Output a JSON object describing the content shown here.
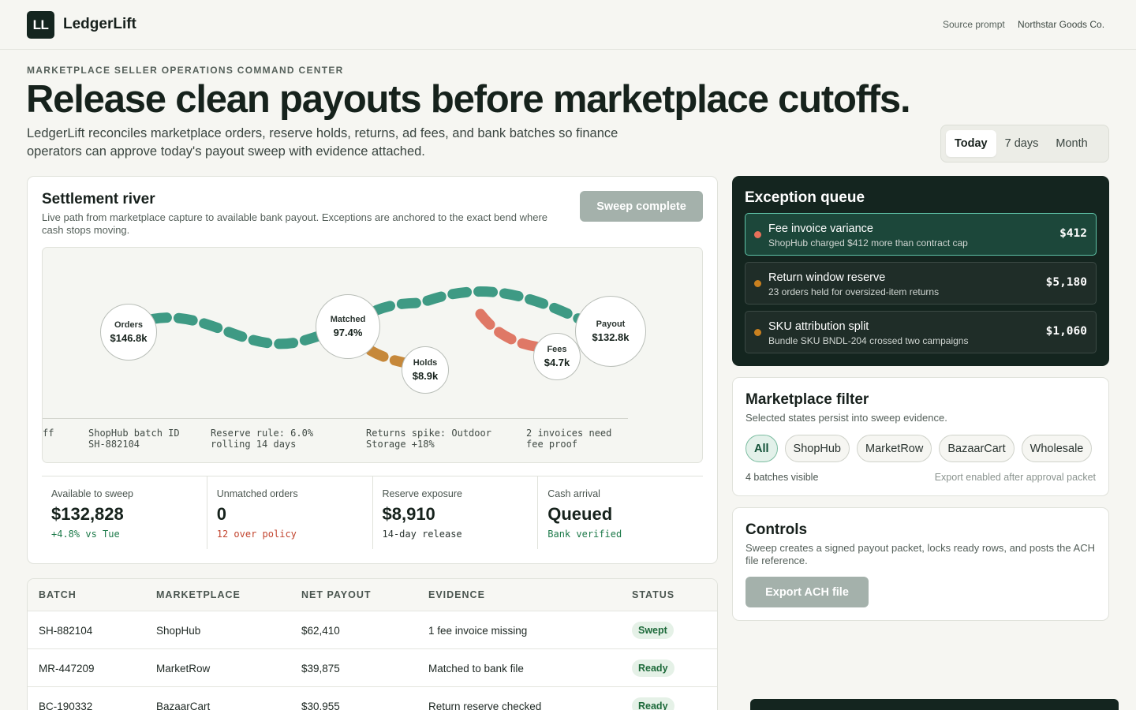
{
  "app": {
    "logo": "LL",
    "name": "LedgerLift",
    "source_label": "Source prompt",
    "source_value": "Northstar Goods Co."
  },
  "hero": {
    "eyebrow": "MARKETPLACE SELLER OPERATIONS COMMAND CENTER",
    "headline": "Release clean payouts before marketplace cutoffs.",
    "lede": "LedgerLift reconciles marketplace orders, reserve holds, returns, ad fees, and bank batches so finance operators can approve today's payout sweep with evidence attached."
  },
  "range": {
    "options": [
      "Today",
      "7 days",
      "Month"
    ],
    "selected": "Today"
  },
  "settlement": {
    "title": "Settlement river",
    "subtitle": "Live path from marketplace capture to available bank payout. Exceptions are anchored to the exact bend where cash stops moving.",
    "button": "Sweep complete",
    "nodes": {
      "orders": {
        "label": "Orders",
        "value": "$146.8k"
      },
      "matched": {
        "label": "Matched",
        "value": "97.4%"
      },
      "holds": {
        "label": "Holds",
        "value": "$8.9k"
      },
      "fees": {
        "label": "Fees",
        "value": "$4.7k"
      },
      "payout": {
        "label": "Payout",
        "value": "$132.8k"
      }
    },
    "annotations": [
      "ff",
      "ShopHub batch ID\nSH-882104",
      "Reserve rule: 6.0%\nrolling 14 days",
      "Returns spike: Outdoor\nStorage +18%",
      "2 invoices need\nfee proof"
    ],
    "colors": {
      "main": "#3e9a84",
      "holds": "#c6883a",
      "fees": "#df7866"
    }
  },
  "metrics": [
    {
      "label": "Available to sweep",
      "value": "$132,828",
      "note": "+4.8% vs Tue",
      "note_color": "#1d7a4a"
    },
    {
      "label": "Unmatched orders",
      "value": "0",
      "note": "12 over policy",
      "note_color": "#c2452f"
    },
    {
      "label": "Reserve exposure",
      "value": "$8,910",
      "note": "14-day release",
      "note_color": "#2a3430"
    },
    {
      "label": "Cash arrival",
      "value": "Queued",
      "note": "Bank verified",
      "note_color": "#1d7a4a"
    }
  ],
  "table": {
    "headers": [
      "BATCH",
      "MARKETPLACE",
      "NET PAYOUT",
      "EVIDENCE",
      "STATUS"
    ],
    "rows": [
      {
        "batch": "SH-882104",
        "marketplace": "ShopHub",
        "net": "$62,410",
        "evidence": "1 fee invoice missing",
        "status": "Swept"
      },
      {
        "batch": "MR-447209",
        "marketplace": "MarketRow",
        "net": "$39,875",
        "evidence": "Matched to bank file",
        "status": "Ready"
      },
      {
        "batch": "BC-190332",
        "marketplace": "BazaarCart",
        "net": "$30,955",
        "evidence": "Return reserve checked",
        "status": "Ready"
      }
    ]
  },
  "queue": {
    "title": "Exception queue",
    "items": [
      {
        "title": "Fee invoice variance",
        "detail": "ShopHub charged $412 more than contract cap",
        "amount": "$412",
        "dot": "#e8705a"
      },
      {
        "title": "Return window reserve",
        "detail": "23 orders held for oversized-item returns",
        "amount": "$5,180",
        "dot": "#c9801f"
      },
      {
        "title": "SKU attribution split",
        "detail": "Bundle SKU BNDL-204 crossed two campaigns",
        "amount": "$1,060",
        "dot": "#c9801f"
      }
    ]
  },
  "filter": {
    "title": "Marketplace filter",
    "subtitle": "Selected states persist into sweep evidence.",
    "chips": [
      "All",
      "ShopHub",
      "MarketRow",
      "BazaarCart",
      "Wholesale"
    ],
    "selected": "All",
    "count": "4 batches visible",
    "note": "Export enabled after approval packet"
  },
  "controls": {
    "title": "Controls",
    "subtitle": "Sweep creates a signed payout packet, locks ready rows, and posts the ACH file reference.",
    "button": "Export ACH file"
  }
}
